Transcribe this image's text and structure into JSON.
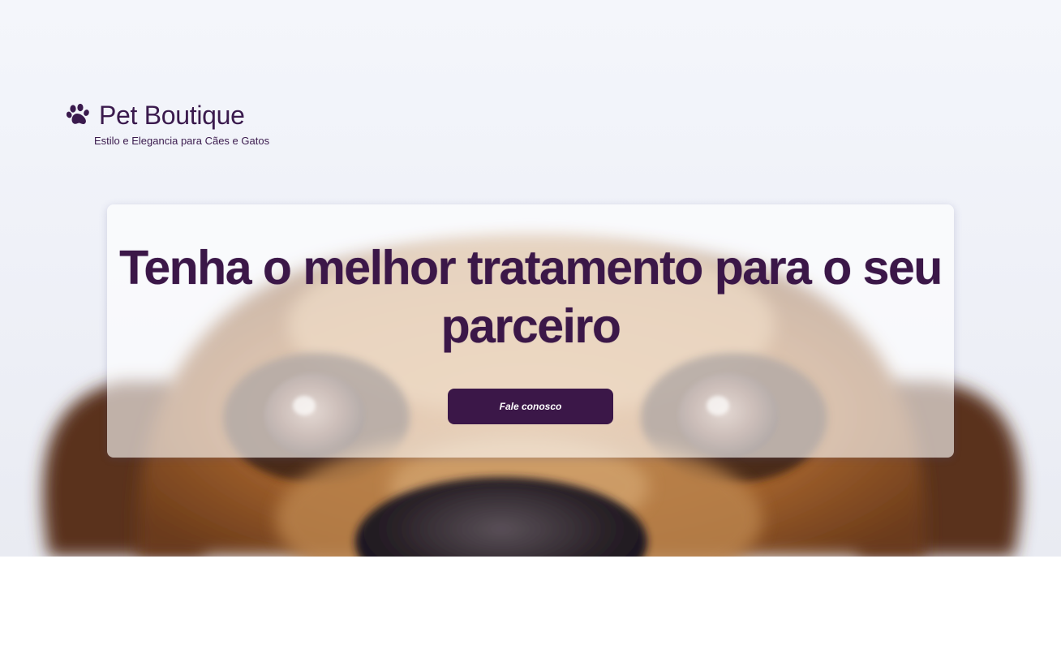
{
  "brand": {
    "name": "Pet Boutique",
    "tagline": "Estilo e Elegancia para Cães e Gatos",
    "icon": "paw-icon",
    "color": "#3a1a4d"
  },
  "hero": {
    "title": "Tenha o melhor tratamento para o seu parceiro",
    "cta_label": "Fale conosco",
    "image": "dog-face-photo"
  },
  "next_section": {
    "title": ""
  },
  "colors": {
    "primary": "#3b1748",
    "background": "#f2f4fa"
  }
}
